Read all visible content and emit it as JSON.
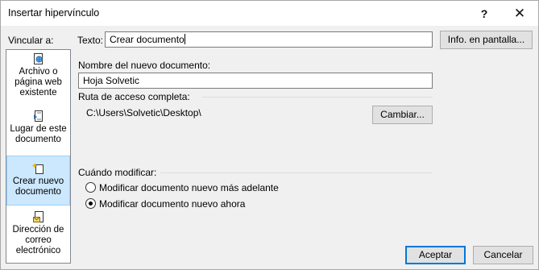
{
  "window": {
    "title": "Insertar hipervínculo",
    "help_label": "?",
    "close_label": "✕"
  },
  "link_to_label": "Vincular a:",
  "text_label": "Texto:",
  "text_value": "Crear documento",
  "screentip_button": "Info. en pantalla...",
  "sidebar": {
    "items": [
      {
        "label_line1": "Archivo o",
        "label_line2": "página web",
        "label_line3": "existente",
        "icon": "existing-file-icon"
      },
      {
        "label_line1": "Lugar de este",
        "label_line2": "documento",
        "icon": "place-in-document-icon"
      },
      {
        "label_line1": "Crear nuevo",
        "label_line2": "documento",
        "icon": "new-document-icon",
        "selected": true
      },
      {
        "label_line1": "Dirección de",
        "label_line2": "correo",
        "label_line3": "electrónico",
        "icon": "email-icon"
      }
    ]
  },
  "new_doc_name_label": "Nombre del nuevo documento:",
  "new_doc_name_value": "Hoja Solvetic",
  "full_path_label": "Ruta de acceso completa:",
  "full_path_value": "C:\\Users\\Solvetic\\Desktop\\",
  "change_button": "Cambiar...",
  "when_to_edit_label": "Cuándo modificar:",
  "radio_options": [
    {
      "label": "Modificar documento nuevo más adelante",
      "checked": false
    },
    {
      "label": "Modificar documento nuevo ahora",
      "checked": true
    }
  ],
  "ok_button": "Aceptar",
  "cancel_button": "Cancelar"
}
